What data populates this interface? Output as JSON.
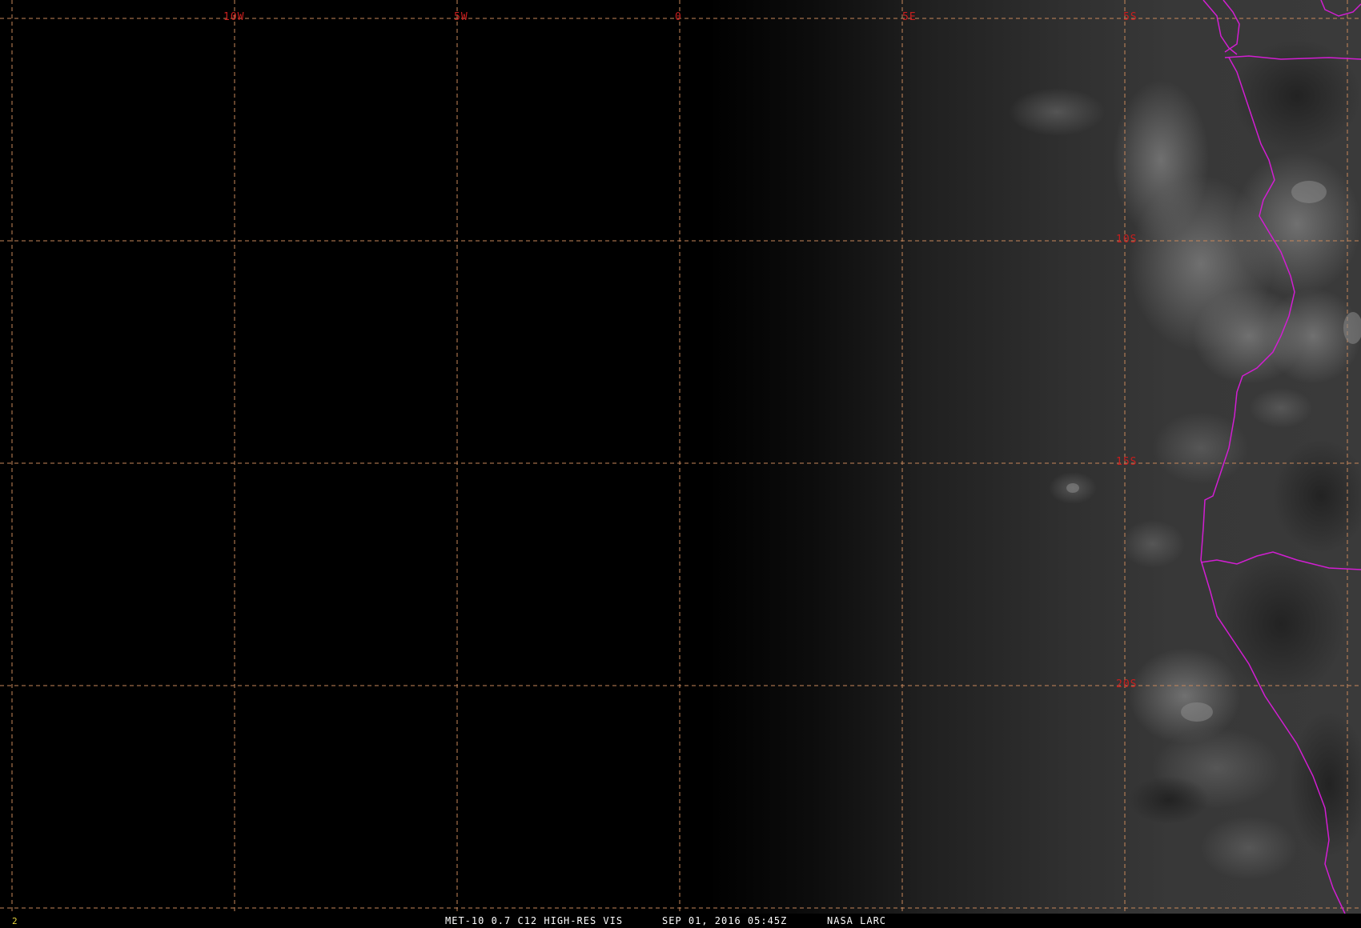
{
  "map": {
    "colors": {
      "background": "#000000",
      "gridline": "#c8875a",
      "grid_label": "#c81e1e",
      "coastline": "#d21ed2",
      "status_text": "#ffffff",
      "frame_number": "#e6d23c"
    },
    "longitude_labels": [
      "10W",
      "5W",
      "0",
      "5E",
      "5S"
    ],
    "latitude_labels": [
      "10S",
      "15S",
      "20S"
    ],
    "longitude_values": [
      -10,
      -5,
      0,
      5
    ],
    "latitude_values": [
      -5,
      -10,
      -15,
      -20
    ],
    "projection": "satellite visible imagery with lat/lon grid"
  },
  "status_bar": {
    "frame_number": "2",
    "product": "MET-10 0.7 C12 HIGH-RES VIS",
    "datetime": "SEP 01, 2016 05:45Z",
    "source": "NASA LARC"
  }
}
